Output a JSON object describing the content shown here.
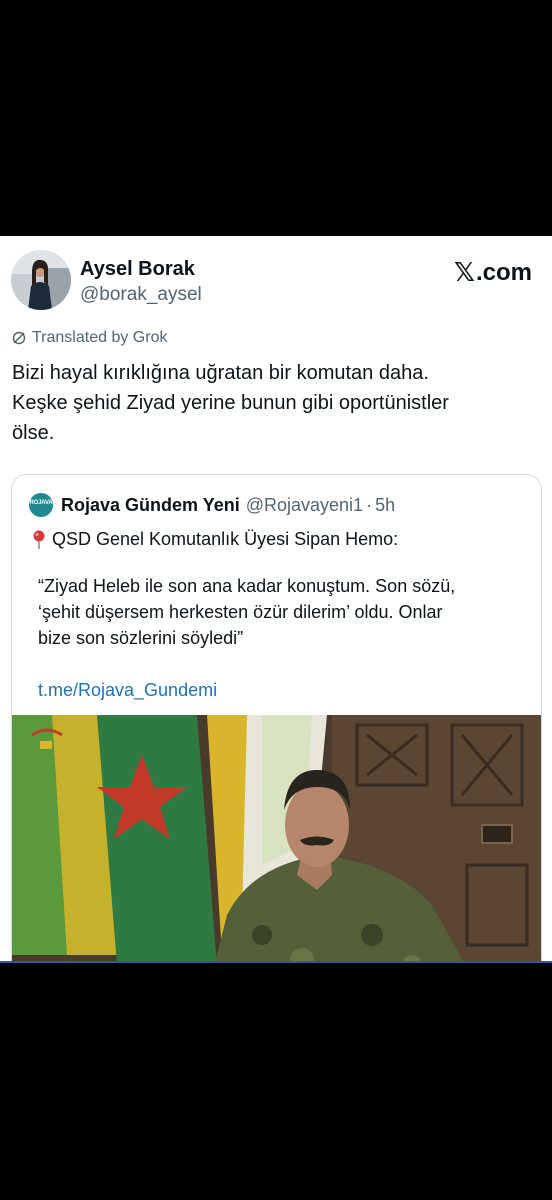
{
  "author": {
    "name": "Aysel Borak",
    "handle": "@borak_aysel"
  },
  "brand": {
    "label": ".com",
    "icon": "x-logo-icon"
  },
  "translated_label": "Translated by Grok",
  "tweet_text": "Bizi hayal kırıklığına uğratan bir komutan daha.\nKeşke şehid Ziyad yerine bunun gibi oportünistler\nölse.",
  "quote": {
    "logo_text": "ROJAVA",
    "name": "Rojava Gündem Yeni",
    "handle": "@Rojavayeni1",
    "separator": "·",
    "time": "5h",
    "headline": "QSD Genel Komutanlık Üyesi Sipan Hemo:",
    "body": "“Ziyad Heleb ile son ana kadar konuştum. Son sözü,\n‘şehit düşersem herkesten özür dilerim’ oldu. Onlar\nbize son sözlerini söyledi”",
    "link": "t.me/Rojava_Gundemi"
  },
  "colors": {
    "text": "#0f1419",
    "secondary": "#536471",
    "link": "#1d72b8",
    "border": "#cfd9de"
  }
}
